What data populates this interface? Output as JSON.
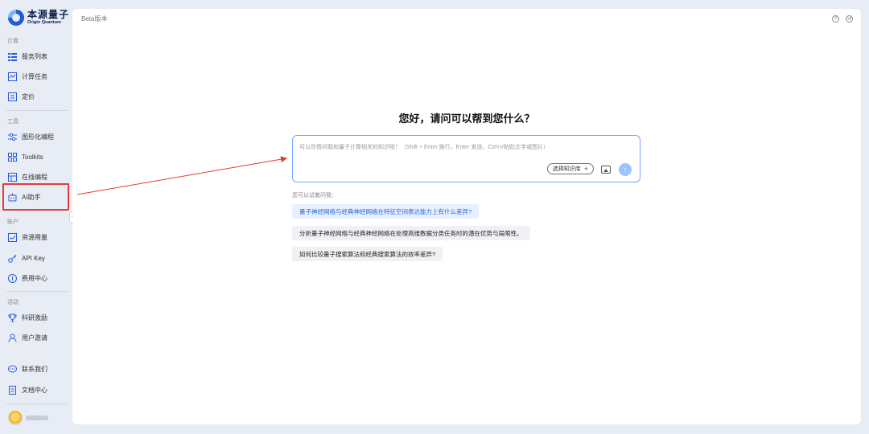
{
  "brand": {
    "name_cn": "本源量子",
    "name_en": "Origin Quantum"
  },
  "sidebar": {
    "sections": [
      {
        "label": "计算"
      },
      {
        "label": "工具"
      },
      {
        "label": "账户"
      },
      {
        "label": "活动"
      }
    ],
    "items": [
      {
        "label": "服务列表",
        "icon": "list-icon"
      },
      {
        "label": "计算任务",
        "icon": "task-icon"
      },
      {
        "label": "定价",
        "icon": "pricing-icon"
      },
      {
        "label": "图形化编程",
        "icon": "graph-program-icon"
      },
      {
        "label": "Toolkits",
        "icon": "toolkits-icon"
      },
      {
        "label": "在线编程",
        "icon": "code-icon"
      },
      {
        "label": "AI助手",
        "icon": "robot-icon"
      },
      {
        "label": "资源用量",
        "icon": "chart-icon"
      },
      {
        "label": "API Key",
        "icon": "key-icon"
      },
      {
        "label": "费用中心",
        "icon": "coin-icon"
      },
      {
        "label": "科研激励",
        "icon": "trophy-icon"
      },
      {
        "label": "用户邀请",
        "icon": "user-icon"
      },
      {
        "label": "联系我们",
        "icon": "chat-icon"
      },
      {
        "label": "文档中心",
        "icon": "doc-icon"
      }
    ],
    "collapse_glyph": "‹"
  },
  "header": {
    "beta_label": "Beta版本"
  },
  "assistant": {
    "greeting": "您好，请问可以帮到您什么？",
    "input_placeholder": "可以尽情问我和量子计算相关的知识啦！（Shift + Enter 换行，Enter 发送，Ctrl+V粘贴文字或图片）",
    "kb_button": "选择知识库",
    "kb_plus": "+",
    "send_glyph": "↑",
    "suggest_label": "您可以试着问我：",
    "suggestions": [
      "量子神经网络与经典神经网络在特征空间表达能力上有什么差异?",
      "分析量子神经网络与经典神经网络在处理高维数据分类任务时的潜在优势与局限性。",
      "如何比较量子搜索算法和经典搜索算法的效率差异?"
    ]
  },
  "annotation_color": "#e53935"
}
